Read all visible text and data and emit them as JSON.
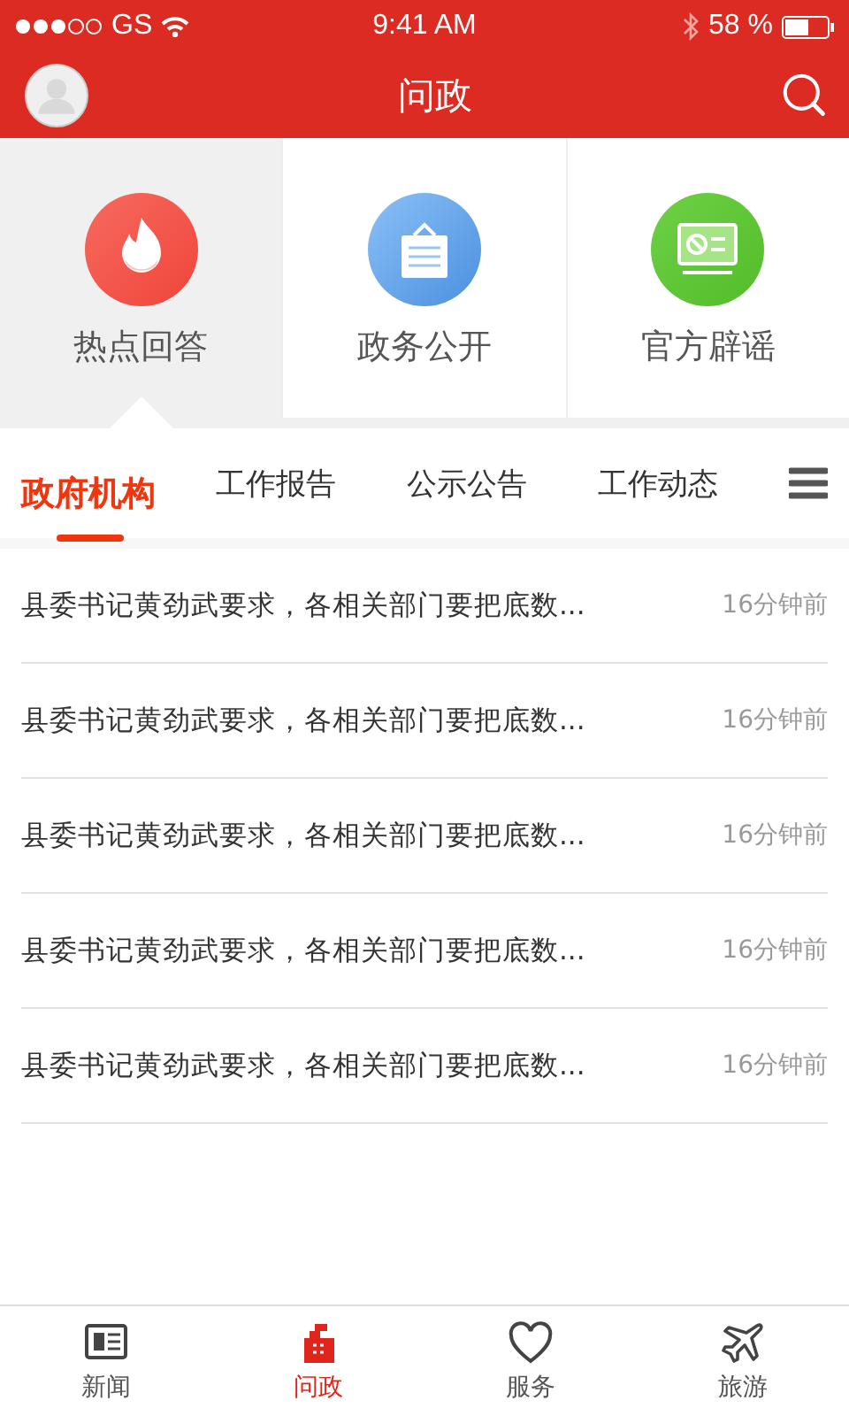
{
  "status_bar": {
    "carrier": "GS",
    "time": "9:41 AM",
    "battery": "58 %"
  },
  "header": {
    "title": "问政"
  },
  "shortcuts": [
    {
      "label": "热点回答",
      "kind": "fire",
      "selected": true
    },
    {
      "label": "政务公开",
      "kind": "notice",
      "selected": false
    },
    {
      "label": "官方辟谣",
      "kind": "screen",
      "selected": false
    }
  ],
  "tabs": [
    {
      "label": "政府机构",
      "selected": true
    },
    {
      "label": "工作报告",
      "selected": false
    },
    {
      "label": "公示公告",
      "selected": false
    },
    {
      "label": "工作动态",
      "selected": false
    }
  ],
  "news": [
    {
      "title": "县委书记黄劲武要求，各相关部门要把底数...",
      "time": "16分钟前"
    },
    {
      "title": "县委书记黄劲武要求，各相关部门要把底数...",
      "time": "16分钟前"
    },
    {
      "title": "县委书记黄劲武要求，各相关部门要把底数...",
      "time": "16分钟前"
    },
    {
      "title": "县委书记黄劲武要求，各相关部门要把底数...",
      "time": "16分钟前"
    },
    {
      "title": "县委书记黄劲武要求，各相关部门要把底数...",
      "time": "16分钟前"
    }
  ],
  "bottom_nav": [
    {
      "label": "新闻",
      "kind": "news",
      "selected": false
    },
    {
      "label": "问政",
      "kind": "building",
      "selected": true
    },
    {
      "label": "服务",
      "kind": "heart",
      "selected": false
    },
    {
      "label": "旅游",
      "kind": "plane",
      "selected": false
    }
  ]
}
